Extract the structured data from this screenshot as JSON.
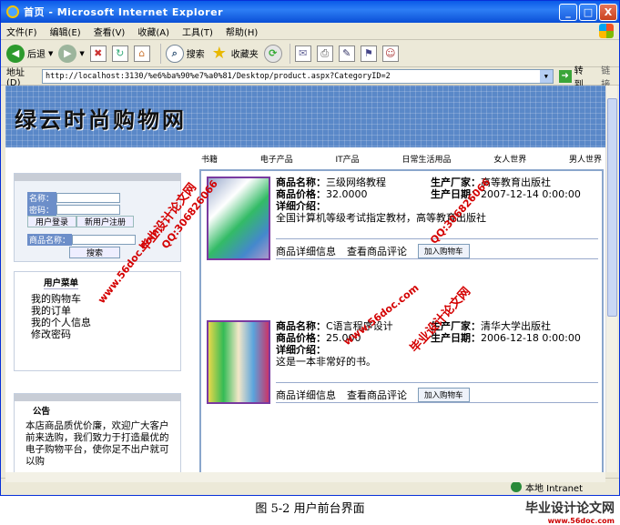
{
  "window": {
    "title": "首页 - Microsoft Internet Explorer",
    "controls": [
      "_",
      "□",
      "X"
    ]
  },
  "menubar": [
    "文件(F)",
    "编辑(E)",
    "查看(V)",
    "收藏(A)",
    "工具(T)",
    "帮助(H)"
  ],
  "toolbar": {
    "back": "后退",
    "search": "搜索",
    "favorites": "收藏夹"
  },
  "address": {
    "label": "地址(D)",
    "url": "http://localhost:3130/%e6%ba%90%e7%a0%81/Desktop/product.aspx?CategoryID=2",
    "go": "转到",
    "links": "链接"
  },
  "site": {
    "logo": "绿云时尚购物网",
    "nav": [
      "书籍",
      "电子产品",
      "IT产品",
      "日常生活用品",
      "女人世界",
      "男人世界"
    ],
    "login": {
      "name_label": "名称：",
      "password_label": "密码：",
      "login_button": "用户登录",
      "register_button": "新用户注册",
      "product_name_label": "商品名称：",
      "search_button": "搜索"
    },
    "user_menu": {
      "title": "用户菜单",
      "items": [
        "我的购物车",
        "我的订单",
        "我的个人信息",
        "修改密码"
      ]
    },
    "notice": {
      "title": "公告",
      "body": "本店商品质优价廉，欢迎广大客户前来选购，我们致力于打造最优的电子购物平台，使你足不出户就可以购"
    }
  },
  "products": [
    {
      "name_label": "商品名称：",
      "name": "三级网络教程",
      "maker_label": "生产厂家：",
      "maker": "高等教育出版社",
      "price_label": "商品价格：",
      "price": "32.0000",
      "date_label": "生产日期：",
      "date": "2007-12-14 0:00:00",
      "detail_label": "详细介绍：",
      "detail": "全国计算机等级考试指定教材，高等教育出版社",
      "link_detail": "商品详细信息",
      "link_review": "查看商品评论",
      "cart_button": "加入购物车"
    },
    {
      "name_label": "商品名称：",
      "name": "C语言程序设计",
      "maker_label": "生产厂家：",
      "maker": "清华大学出版社",
      "price_label": "商品价格：",
      "price": "25.000",
      "date_label": "生产日期：",
      "date": "2006-12-18 0:00:00",
      "detail_label": "详细介绍：",
      "detail": "这是一本非常好的书。",
      "link_detail": "商品详细信息",
      "link_review": "查看商品评论",
      "cart_button": "加入购物车"
    }
  ],
  "watermarks": {
    "site": "毕业设计论文网",
    "url": "www.56doc.com",
    "qq": "QQ:306826066"
  },
  "statusbar": {
    "zone": "本地 Intranet"
  },
  "caption": "图 5-2 用户前台界面",
  "caption_logo": {
    "name": "毕业设计论文网",
    "url": "www.56doc.com"
  },
  "colors": {
    "banner": "#5a88c8",
    "titlebar": "#0a5ae8",
    "watermark": "#d40000"
  }
}
